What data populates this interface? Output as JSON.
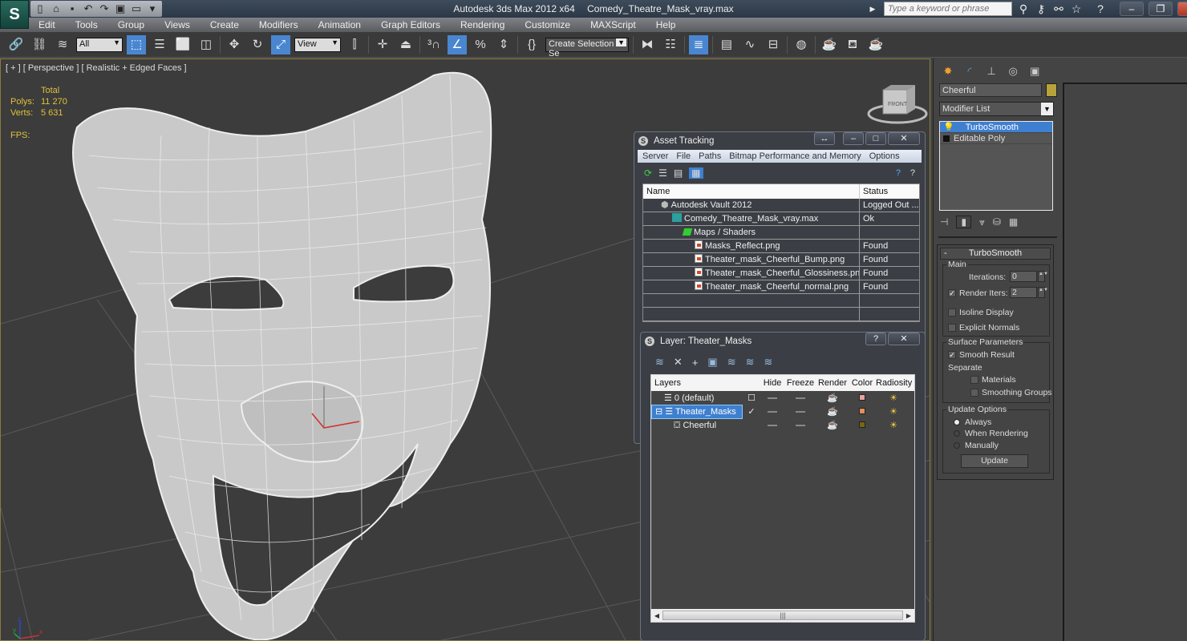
{
  "app": {
    "title": "Autodesk 3ds Max  2012 x64",
    "file": "Comedy_Theatre_Mask_vray.max",
    "logo": "S"
  },
  "quick_access": [
    {
      "icon": "new-file-icon",
      "glyph": "🗋"
    },
    {
      "icon": "open-folder-icon",
      "glyph": "📂"
    },
    {
      "icon": "save-icon",
      "glyph": "💾"
    },
    {
      "icon": "undo-icon",
      "glyph": "↶"
    },
    {
      "icon": "redo-icon",
      "glyph": "↷"
    },
    {
      "icon": "project-folder-icon",
      "glyph": "▣"
    },
    {
      "icon": "window-icon",
      "glyph": "▭"
    },
    {
      "icon": "customize-dropdown-icon",
      "glyph": "▾"
    }
  ],
  "search": {
    "placeholder": "Type a keyword or phrase"
  },
  "menu": [
    "Edit",
    "Tools",
    "Group",
    "Views",
    "Create",
    "Modifiers",
    "Animation",
    "Graph Editors",
    "Rendering",
    "Customize",
    "MAXScript",
    "Help"
  ],
  "toolbar": {
    "selection_filter": "All",
    "ref_coord": "View",
    "named_selection": "Create Selection Se"
  },
  "viewport": {
    "label": "[ + ] [ Perspective ] [ Realistic + Edged Faces ]",
    "stats": {
      "header": "Total",
      "polys_label": "Polys:",
      "polys": "11 270",
      "verts_label": "Verts:",
      "verts": "5 631",
      "fps_label": "FPS:"
    },
    "viewcube_label": "FRONT",
    "axes": {
      "x": "x",
      "y": "y",
      "z": "z"
    }
  },
  "asset_tracking": {
    "title": "Asset Tracking",
    "menu": [
      "Server",
      "File",
      "Paths",
      "Bitmap Performance and Memory",
      "Options"
    ],
    "columns": [
      "Name",
      "Status"
    ],
    "rows": [
      {
        "name": "Autodesk Vault 2012",
        "status": "Logged Out ...",
        "indent": 1,
        "icon": "vault-icon"
      },
      {
        "name": "Comedy_Theatre_Mask_vray.max",
        "status": "Ok",
        "indent": 2,
        "icon": "max-file-icon"
      },
      {
        "name": "Maps / Shaders",
        "status": "",
        "indent": 3,
        "icon": "maps-icon"
      },
      {
        "name": "Masks_Reflect.png",
        "status": "Found",
        "indent": 4,
        "icon": "bitmap-icon"
      },
      {
        "name": "Theater_mask_Cheerful_Bump.png",
        "status": "Found",
        "indent": 4,
        "icon": "bitmap-icon"
      },
      {
        "name": "Theater_mask_Cheerful_Glossiness.png",
        "status": "Found",
        "indent": 4,
        "icon": "bitmap-icon"
      },
      {
        "name": "Theater_mask_Cheerful_normal.png",
        "status": "Found",
        "indent": 4,
        "icon": "bitmap-icon"
      }
    ]
  },
  "layer_dialog": {
    "title": "Layer: Theater_Masks",
    "columns": [
      "Layers",
      "",
      "Hide",
      "Freeze",
      "Render",
      "Color",
      "Radiosity"
    ],
    "rows": [
      {
        "name": "0 (default)",
        "current": "☐",
        "color": "#e6a0a0",
        "indent": 1,
        "selected": false
      },
      {
        "name": "Theater_Masks",
        "current": "✓",
        "color": "#e0905a",
        "indent": 0,
        "selected": true
      },
      {
        "name": "Cheerful",
        "current": "",
        "color": "#7a6410",
        "indent": 2,
        "selected": false
      }
    ]
  },
  "command_panel": {
    "object_name": "Cheerful",
    "object_color": "#b8a23a",
    "modifier_list": "Modifier List",
    "stack": [
      "TurboSmooth",
      "Editable Poly"
    ],
    "rollout_title": "TurboSmooth",
    "main_label": "Main",
    "iterations_label": "Iterations:",
    "iterations": "0",
    "render_iters_label": "Render Iters:",
    "render_iters": "2",
    "render_iters_checked": true,
    "isoline_label": "Isoline Display",
    "explicit_normals_label": "Explicit Normals",
    "surface_label": "Surface Parameters",
    "smooth_result_label": "Smooth Result",
    "separate_label": "Separate",
    "materials_label": "Materials",
    "smoothing_groups_label": "Smoothing Groups",
    "update_label": "Update Options",
    "always_label": "Always",
    "when_rendering_label": "When Rendering",
    "manually_label": "Manually",
    "update_button": "Update",
    "collapse": "-"
  }
}
